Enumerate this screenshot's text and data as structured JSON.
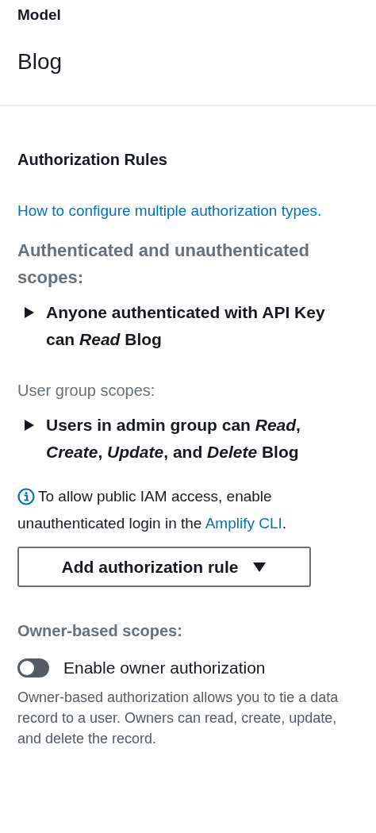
{
  "model": {
    "label": "Model",
    "name": "Blog"
  },
  "authorization": {
    "title": "Authorization Rules",
    "help_link": "How to configure multiple authorization types.",
    "groups": [
      {
        "heading": "Authenticated and unauthenticated scopes:",
        "kind": "strong",
        "rules": [
          {
            "text": "Anyone authenticated with API Key can *Read* Blog",
            "expanded": false
          }
        ]
      },
      {
        "heading": "User group scopes:",
        "kind": "normal",
        "rules": [
          {
            "text": "Users in admin group can *Read*, *Create*, *Update*, and *Delete* Blog",
            "expanded": false
          }
        ]
      }
    ],
    "info": {
      "text_before": "To allow public IAM access, enable unauthenticated login in the ",
      "link": "Amplify CLI",
      "text_after": "."
    },
    "add_button": "Add authorization rule",
    "owner": {
      "heading": "Owner-based scopes:",
      "toggle_label": "Enable owner authorization",
      "on": false,
      "description": "Owner-based authorization allows you to tie a data record to a user. Owners can read, create, update, and delete the record."
    }
  }
}
